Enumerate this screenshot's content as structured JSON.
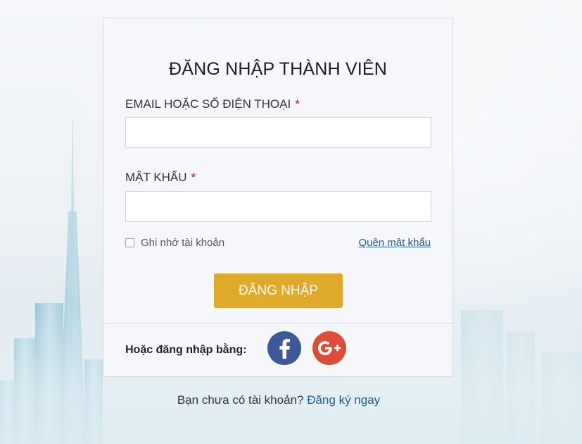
{
  "login": {
    "title": "ĐĂNG NHẬP THÀNH VIÊN",
    "email_label": "EMAIL HOẶC SỐ ĐIỆN THOẠI",
    "password_label": "MẬT KHẨU",
    "required_mark": "*",
    "email_value": "",
    "password_value": "",
    "remember_label": "Ghi nhớ tài khoản",
    "remember_checked": false,
    "forgot_label": "Quên mật khẩu",
    "submit_label": "ĐĂNG NHẬP"
  },
  "social": {
    "label": "Hoặc đăng nhập bằng:",
    "facebook_icon": "facebook-icon",
    "google_icon": "google-plus-icon",
    "facebook_color": "#3b5998",
    "google_color": "#dd4b39"
  },
  "footer": {
    "prompt": "Bạn chưa có tài khoản?",
    "register_link": "Đăng ký ngay"
  },
  "colors": {
    "accent": "#dfa92c",
    "link": "#1f5c8a",
    "required": "#d0021b"
  }
}
